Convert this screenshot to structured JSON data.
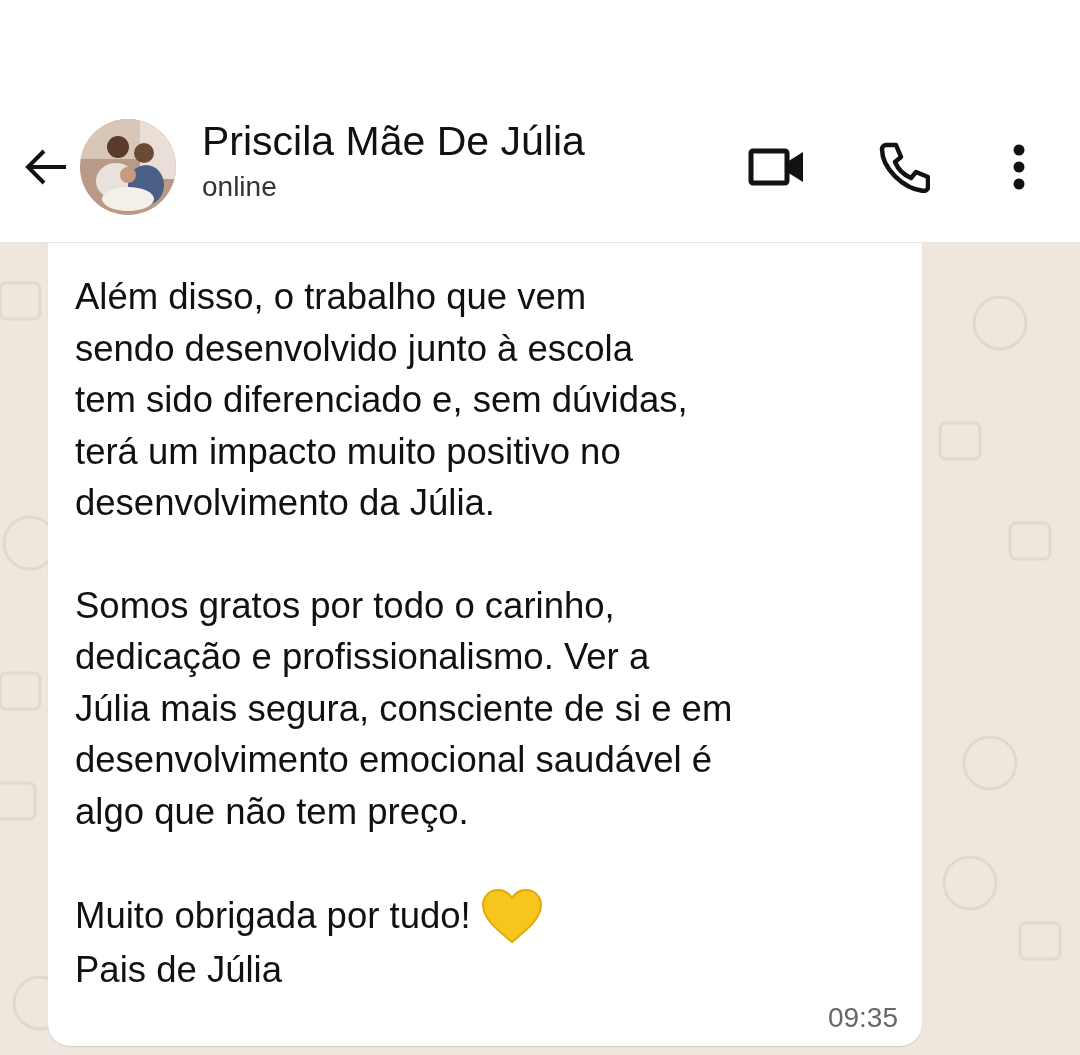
{
  "header": {
    "contact_name": "Priscila Mãe De Júlia",
    "status": "online"
  },
  "message": {
    "paragraphs": [
      {
        "lines": [
          "Além disso, o trabalho que vem",
          "sendo desenvolvido junto à escola",
          "tem sido diferenciado e, sem dúvidas,",
          "terá um impacto muito positivo no",
          "desenvolvimento da Júlia."
        ]
      },
      {
        "lines": [
          "Somos gratos por todo o carinho,",
          "dedicação e profissionalismo. Ver a",
          "Júlia mais segura, consciente de si e em",
          "desenvolvimento emocional saudável é",
          "algo que não tem preço."
        ]
      }
    ],
    "closing": "Muito obrigada por tudo!",
    "signature": "Pais de Júlia",
    "time": "09:35"
  }
}
